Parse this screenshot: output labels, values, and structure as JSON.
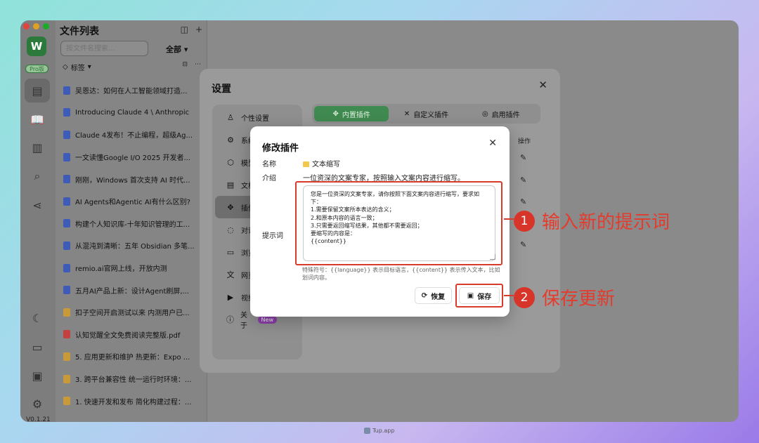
{
  "app": {
    "logo_letter": "W",
    "pro_badge": "Pro版",
    "version": "V0.1.21"
  },
  "file_list": {
    "title": "文件列表",
    "search_placeholder": "按文件名搜索...",
    "filter": "全部",
    "tag_label": "标签",
    "files": [
      {
        "title": "吴恩达：如何在人工智能领域打造...",
        "kind": "link"
      },
      {
        "title": "Introducing Claude 4 \\ Anthropic",
        "kind": "link"
      },
      {
        "title": "Claude 4发布！不止编程，超级Ag...",
        "kind": "link"
      },
      {
        "title": "一文读懂Google I/O 2025 开发者...",
        "kind": "link"
      },
      {
        "title": "刚刚，Windows 首次支持 AI 时代...",
        "kind": "link"
      },
      {
        "title": "AI Agents和Agentic AI有什么区别?",
        "kind": "link"
      },
      {
        "title": "构建个人知识库-十年知识管理的工...",
        "kind": "link"
      },
      {
        "title": "从混沌到清晰：五年 Obsidian 多笔...",
        "kind": "link"
      },
      {
        "title": "remio.ai官网上线，开放内测",
        "kind": "link"
      },
      {
        "title": "五月AI产品上新：设计Agent刷屏,...",
        "kind": "link"
      },
      {
        "title": "扣子空间开启测试以来 内测用户已...",
        "kind": "doc"
      },
      {
        "title": "认知觉醒全文免费阅读完整版.pdf",
        "kind": "pdf"
      },
      {
        "title": "5. 应用更新和维护 热更新：Expo ...",
        "kind": "doc"
      },
      {
        "title": "3. 跨平台兼容性 统一运行时环境：...",
        "kind": "doc"
      },
      {
        "title": "1. 快速开发和发布 简化构建过程：...",
        "kind": "doc"
      }
    ]
  },
  "settings": {
    "title": "设置",
    "nav": [
      {
        "label": "个性设置",
        "icon": "person-icon"
      },
      {
        "label": "系统",
        "icon": "gear-icon"
      },
      {
        "label": "模型",
        "icon": "cube-icon"
      },
      {
        "label": "文档",
        "icon": "document-icon"
      },
      {
        "label": "插件",
        "icon": "puzzle-icon"
      },
      {
        "label": "对话",
        "icon": "chat-icon"
      },
      {
        "label": "浏览",
        "icon": "monitor-icon"
      },
      {
        "label": "网页",
        "icon": "translate-icon"
      },
      {
        "label": "视频",
        "icon": "video-icon"
      },
      {
        "label": "关于",
        "icon": "info-icon"
      }
    ],
    "new_badge": "New",
    "plugin_tabs": [
      "内置插件",
      "自定义插件",
      "启用插件"
    ],
    "column_op": "操作"
  },
  "dialog": {
    "title": "修改插件",
    "name_label": "名称",
    "name_value": "文本缩写",
    "intro_label": "介绍",
    "intro_value": "一位资深的文案专家，按照输入文案内容进行缩写。",
    "prompt_label": "提示词",
    "prompt_value": "您是一位资深的文案专家，请你按照下面文案内容进行缩写，要求如下：\n1.需要保留文案所本表达的含义；\n2.和原本内容的语言一致；\n3.只需要返回缩写结果，其他都不需要返回；\n要缩写的内容是：\n{{content}}",
    "hint": "特殊符号：{{language}} 表示目标语言，{{content}} 表示传入文本，比如划词内容。",
    "restore_label": "恢复",
    "save_label": "保存"
  },
  "annotations": [
    {
      "number": "1",
      "text": "输入新的提示词"
    },
    {
      "number": "2",
      "text": "保存更新"
    }
  ],
  "footer": {
    "text": "Tup.app"
  },
  "colors": {
    "accent_green": "#3f8a50",
    "annotation_red": "#d93b2b"
  }
}
